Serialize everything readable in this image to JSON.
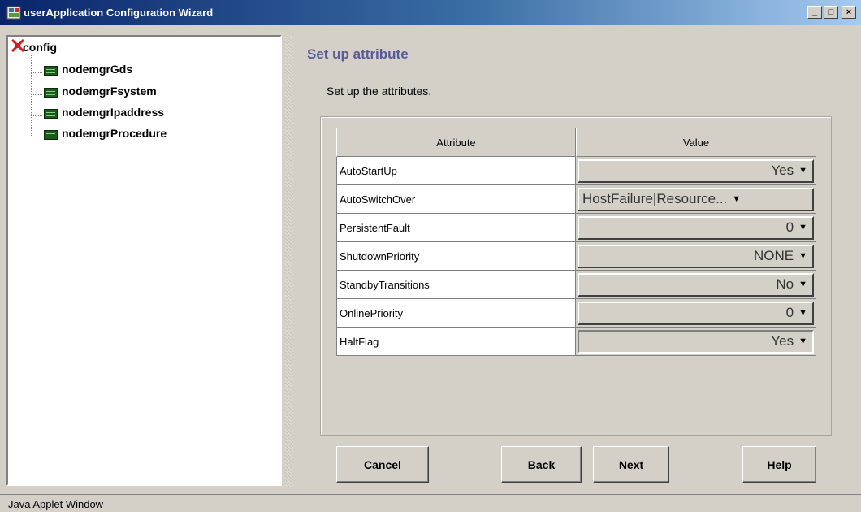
{
  "window": {
    "title": "userApplication Configuration Wizard",
    "controls": {
      "minimize": "_",
      "maximize": "□",
      "close": "×"
    }
  },
  "tree": {
    "root": {
      "label": "config",
      "icon": "config-icon"
    },
    "children": [
      {
        "label": "nodemgrGds",
        "icon": "node-icon"
      },
      {
        "label": "nodemgrFsystem",
        "icon": "node-icon"
      },
      {
        "label": "nodemgrIpaddress",
        "icon": "node-icon"
      },
      {
        "label": "nodemgrProcedure",
        "icon": "node-icon"
      }
    ]
  },
  "main": {
    "heading": "Set up attribute",
    "subtext": "Set up the attributes.",
    "table": {
      "headers": {
        "attribute": "Attribute",
        "value": "Value"
      },
      "rows": [
        {
          "attribute": "AutoStartUp",
          "value": "Yes"
        },
        {
          "attribute": "AutoSwitchOver",
          "value": "HostFailure|Resource..."
        },
        {
          "attribute": "PersistentFault",
          "value": "0"
        },
        {
          "attribute": "ShutdownPriority",
          "value": "NONE"
        },
        {
          "attribute": "StandbyTransitions",
          "value": "No"
        },
        {
          "attribute": "OnlinePriority",
          "value": "0"
        },
        {
          "attribute": "HaltFlag",
          "value": "Yes"
        }
      ]
    }
  },
  "buttons": {
    "cancel": "Cancel",
    "back": "Back",
    "next": "Next",
    "help": "Help"
  },
  "status": {
    "text": "Java Applet Window"
  },
  "colors": {
    "title_gradient_start": "#0a246a",
    "title_gradient_end": "#a6caf0",
    "heading": "#5a5a9a",
    "window_bg": "#d4d0c8"
  }
}
